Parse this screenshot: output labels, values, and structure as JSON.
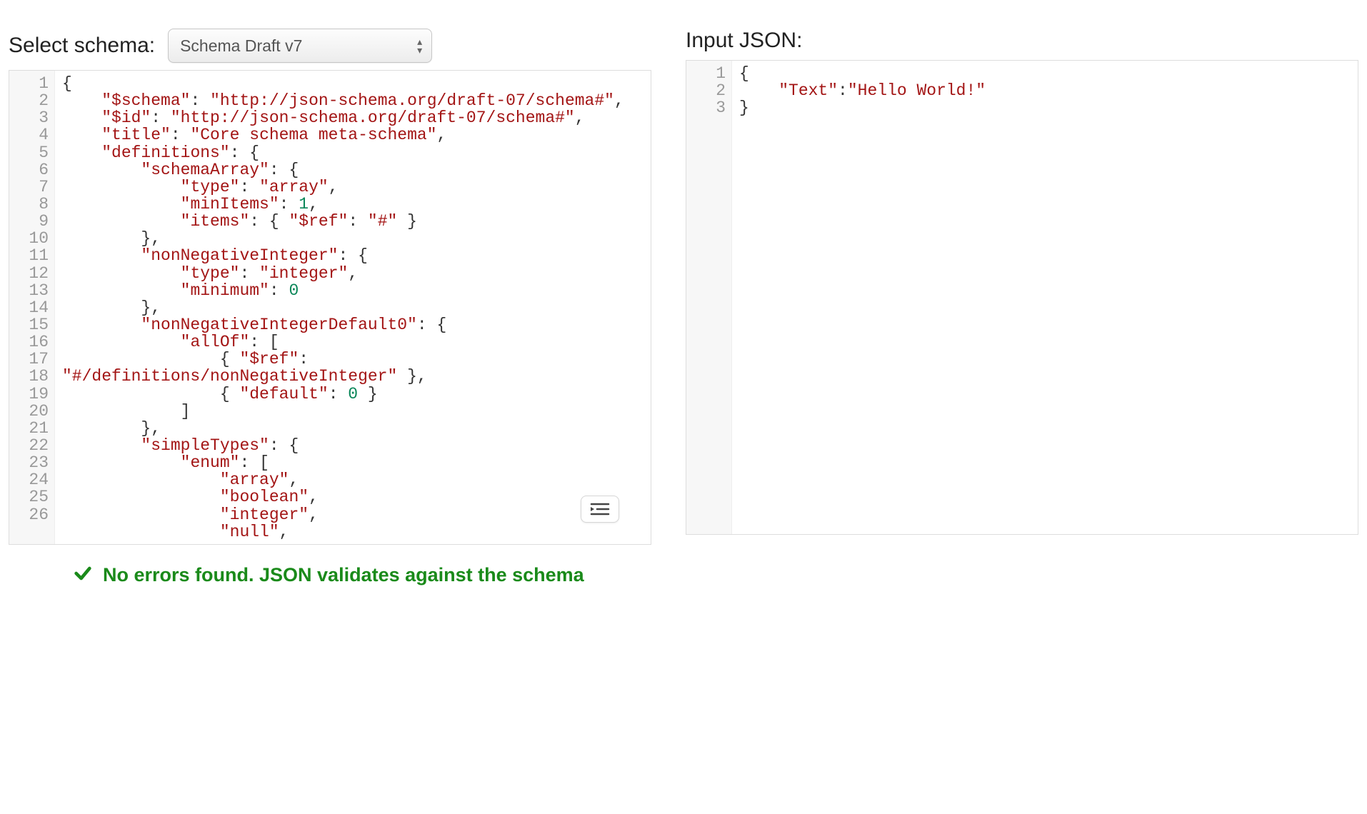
{
  "leftPanel": {
    "label": "Select schema:",
    "selectedOption": "Schema Draft v7",
    "editorLines": [
      [
        {
          "p": "{"
        }
      ],
      [
        {
          "p": "    "
        },
        {
          "k": "\"$schema\""
        },
        {
          "p": ": "
        },
        {
          "s": "\"http://json-schema.org/draft-07/schema#\""
        },
        {
          "p": ","
        }
      ],
      [
        {
          "p": "    "
        },
        {
          "k": "\"$id\""
        },
        {
          "p": ": "
        },
        {
          "s": "\"http://json-schema.org/draft-07/schema#\""
        },
        {
          "p": ","
        }
      ],
      [
        {
          "p": "    "
        },
        {
          "k": "\"title\""
        },
        {
          "p": ": "
        },
        {
          "s": "\"Core schema meta-schema\""
        },
        {
          "p": ","
        }
      ],
      [
        {
          "p": "    "
        },
        {
          "k": "\"definitions\""
        },
        {
          "p": ": {"
        }
      ],
      [
        {
          "p": "        "
        },
        {
          "k": "\"schemaArray\""
        },
        {
          "p": ": {"
        }
      ],
      [
        {
          "p": "            "
        },
        {
          "k": "\"type\""
        },
        {
          "p": ": "
        },
        {
          "s": "\"array\""
        },
        {
          "p": ","
        }
      ],
      [
        {
          "p": "            "
        },
        {
          "k": "\"minItems\""
        },
        {
          "p": ": "
        },
        {
          "n": "1"
        },
        {
          "p": ","
        }
      ],
      [
        {
          "p": "            "
        },
        {
          "k": "\"items\""
        },
        {
          "p": ": { "
        },
        {
          "k": "\"$ref\""
        },
        {
          "p": ": "
        },
        {
          "s": "\"#\""
        },
        {
          "p": " }"
        }
      ],
      [
        {
          "p": "        },"
        }
      ],
      [
        {
          "p": "        "
        },
        {
          "k": "\"nonNegativeInteger\""
        },
        {
          "p": ": {"
        }
      ],
      [
        {
          "p": "            "
        },
        {
          "k": "\"type\""
        },
        {
          "p": ": "
        },
        {
          "s": "\"integer\""
        },
        {
          "p": ","
        }
      ],
      [
        {
          "p": "            "
        },
        {
          "k": "\"minimum\""
        },
        {
          "p": ": "
        },
        {
          "n": "0"
        }
      ],
      [
        {
          "p": "        },"
        }
      ],
      [
        {
          "p": "        "
        },
        {
          "k": "\"nonNegativeIntegerDefault0\""
        },
        {
          "p": ": {"
        }
      ],
      [
        {
          "p": "            "
        },
        {
          "k": "\"allOf\""
        },
        {
          "p": ": ["
        }
      ],
      [
        {
          "p": "                { "
        },
        {
          "k": "\"$ref\""
        },
        {
          "p": ": "
        },
        {
          "s": "\"#/definitions/nonNegativeInteger\""
        },
        {
          "p": " },"
        }
      ],
      [
        {
          "p": "                { "
        },
        {
          "k": "\"default\""
        },
        {
          "p": ": "
        },
        {
          "n": "0"
        },
        {
          "p": " }"
        }
      ],
      [
        {
          "p": "            ]"
        }
      ],
      [
        {
          "p": "        },"
        }
      ],
      [
        {
          "p": "        "
        },
        {
          "k": "\"simpleTypes\""
        },
        {
          "p": ": {"
        }
      ],
      [
        {
          "p": "            "
        },
        {
          "k": "\"enum\""
        },
        {
          "p": ": ["
        }
      ],
      [
        {
          "p": "                "
        },
        {
          "s": "\"array\""
        },
        {
          "p": ","
        }
      ],
      [
        {
          "p": "                "
        },
        {
          "s": "\"boolean\""
        },
        {
          "p": ","
        }
      ],
      [
        {
          "p": "                "
        },
        {
          "s": "\"integer\""
        },
        {
          "p": ","
        }
      ],
      [
        {
          "p": "                "
        },
        {
          "s": "\"null\""
        },
        {
          "p": ","
        }
      ]
    ],
    "lineCount": 26
  },
  "rightPanel": {
    "label": "Input JSON:",
    "editorLines": [
      [
        {
          "p": "{"
        }
      ],
      [
        {
          "p": "    "
        },
        {
          "k": "\"Text\""
        },
        {
          "p": ":"
        },
        {
          "s": "\"Hello World!\""
        }
      ],
      [
        {
          "p": "}"
        }
      ]
    ],
    "lineCount": 3
  },
  "status": {
    "message": "No errors found. JSON validates against the schema"
  }
}
